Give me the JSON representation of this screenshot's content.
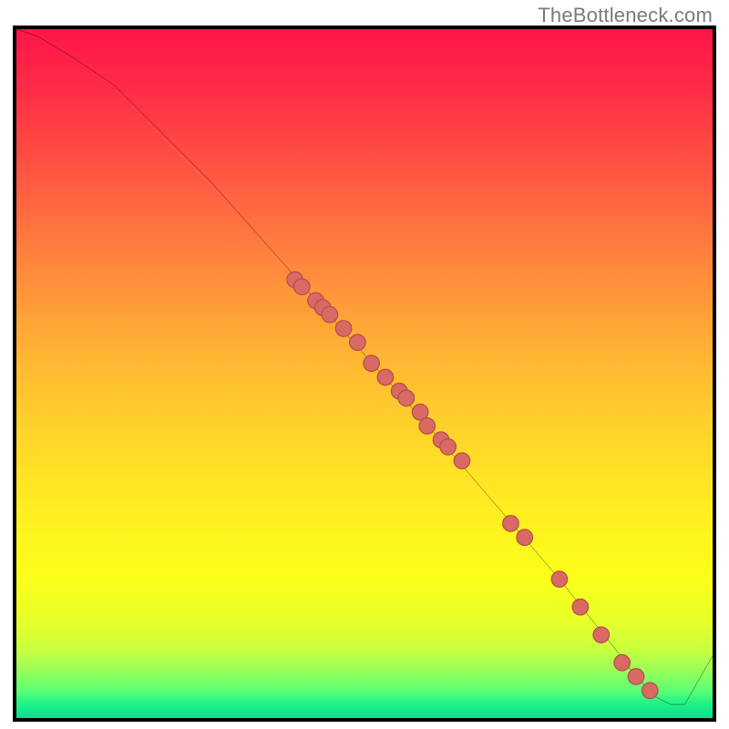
{
  "watermark": {
    "text": "TheBottleneck.com"
  },
  "colors": {
    "frame": "#000000",
    "curve": "#000000",
    "dot_fill": "#d86a63",
    "dot_stroke": "#b24c46"
  },
  "chart_data": {
    "type": "line",
    "title": "",
    "xlabel": "",
    "ylabel": "",
    "xlim": [
      0,
      100
    ],
    "ylim": [
      0,
      100
    ],
    "grid": false,
    "series": [
      {
        "name": "curve",
        "x": [
          0,
          3,
          8,
          14,
          20,
          28,
          36,
          44,
          52,
          60,
          66,
          72,
          78,
          82,
          86,
          89,
          92,
          94,
          96,
          100
        ],
        "y": [
          100,
          99,
          96,
          92,
          86,
          78,
          69,
          60,
          51,
          42,
          35,
          28,
          21,
          16,
          11,
          7,
          4,
          3,
          3,
          10
        ]
      }
    ],
    "points": [
      {
        "x": 40,
        "y": 64
      },
      {
        "x": 41,
        "y": 63
      },
      {
        "x": 43,
        "y": 61
      },
      {
        "x": 44,
        "y": 60
      },
      {
        "x": 45,
        "y": 59
      },
      {
        "x": 47,
        "y": 57
      },
      {
        "x": 49,
        "y": 55
      },
      {
        "x": 51,
        "y": 52
      },
      {
        "x": 53,
        "y": 50
      },
      {
        "x": 55,
        "y": 48
      },
      {
        "x": 56,
        "y": 47
      },
      {
        "x": 58,
        "y": 45
      },
      {
        "x": 59,
        "y": 43
      },
      {
        "x": 61,
        "y": 41
      },
      {
        "x": 62,
        "y": 40
      },
      {
        "x": 64,
        "y": 38
      },
      {
        "x": 71,
        "y": 29
      },
      {
        "x": 73,
        "y": 27
      },
      {
        "x": 78,
        "y": 21
      },
      {
        "x": 81,
        "y": 17
      },
      {
        "x": 84,
        "y": 13
      },
      {
        "x": 87,
        "y": 9
      },
      {
        "x": 89,
        "y": 7
      },
      {
        "x": 91,
        "y": 5
      }
    ]
  }
}
